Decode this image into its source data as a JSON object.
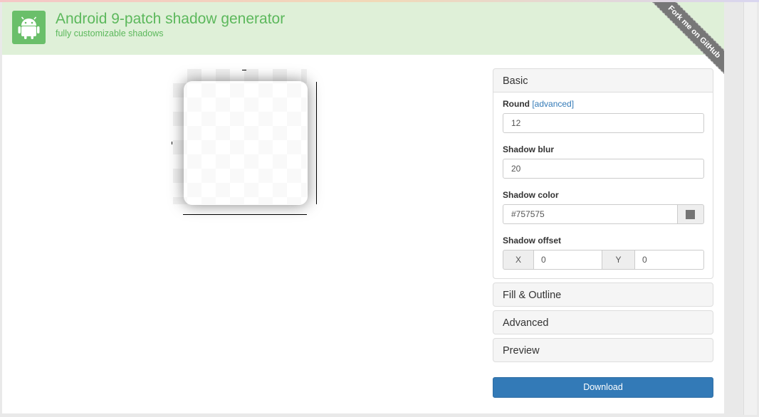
{
  "header": {
    "title": "Android 9-patch shadow generator",
    "subtitle": "fully customizable shadows",
    "logo_icon": "android-robot-icon",
    "accent_color": "#5cb85c",
    "background_color": "#dff0d8"
  },
  "ribbon": {
    "label": "Fork me on GitHub",
    "color": "#777777"
  },
  "sidebar": {
    "basic": {
      "title": "Basic",
      "round": {
        "label": "Round",
        "link": "[advanced]",
        "value": "12"
      },
      "shadow_blur": {
        "label": "Shadow blur",
        "value": "20"
      },
      "shadow_color": {
        "label": "Shadow color",
        "value": "#757575",
        "swatch": "#757575"
      },
      "shadow_offset": {
        "label": "Shadow offset",
        "x_label": "X",
        "x_value": "0",
        "y_label": "Y",
        "y_value": "0"
      }
    },
    "fill_outline": {
      "title": "Fill & Outline"
    },
    "advanced": {
      "title": "Advanced"
    },
    "preview": {
      "title": "Preview"
    },
    "download_label": "Download",
    "download_color": "#337ab7"
  }
}
